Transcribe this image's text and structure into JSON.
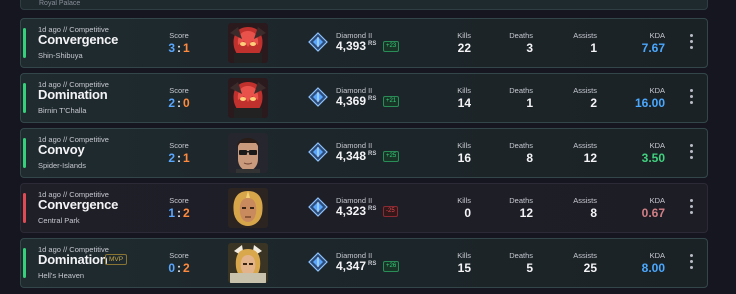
{
  "top_partial": {
    "map": "Royal Palace"
  },
  "labels": {
    "score": "Score",
    "kills": "Kills",
    "deaths": "Deaths",
    "assists": "Assists",
    "kda": "KDA",
    "rs": "RS"
  },
  "matches": [
    {
      "result": "win",
      "meta": "1d ago // Competitive",
      "mode": "Convergence",
      "map": "Shin-Shibuya",
      "score_a": "3",
      "score_b": "1",
      "hero": "hero-portrait-red-masked",
      "rank": "Diamond II",
      "rank_score": "4,393",
      "rank_delta": "+23",
      "kills": "22",
      "deaths": "3",
      "assists": "1",
      "kda": "7.67",
      "kda_color": "#4aa8ff"
    },
    {
      "result": "win",
      "meta": "1d ago // Competitive",
      "mode": "Domination",
      "map": "Birnin T'Challa",
      "score_a": "2",
      "score_b": "0",
      "hero": "hero-portrait-red-masked",
      "rank": "Diamond II",
      "rank_score": "4,369",
      "rank_delta": "+21",
      "kills": "14",
      "deaths": "1",
      "assists": "2",
      "kda": "16.00",
      "kda_color": "#4aa8ff"
    },
    {
      "result": "win",
      "meta": "1d ago // Competitive",
      "mode": "Convoy",
      "map": "Spider-Islands",
      "score_a": "2",
      "score_b": "1",
      "hero": "hero-portrait-glasses",
      "rank": "Diamond II",
      "rank_score": "4,348",
      "rank_delta": "+25",
      "kills": "16",
      "deaths": "8",
      "assists": "12",
      "kda": "3.50",
      "kda_color": "#40d17e"
    },
    {
      "result": "loss",
      "meta": "1d ago // Competitive",
      "mode": "Convergence",
      "map": "Central Park",
      "score_a": "1",
      "score_b": "2",
      "hero": "hero-portrait-gold",
      "rank": "Diamond II",
      "rank_score": "4,323",
      "rank_delta": "-25",
      "kills": "0",
      "deaths": "12",
      "assists": "8",
      "kda": "0.67",
      "kda_color": "#d27f85"
    },
    {
      "result": "win",
      "meta": "1d ago // Competitive",
      "mode": "Domination",
      "map": "Hell's Heaven",
      "mvp": "MVP",
      "score_a": "0",
      "score_b": "2",
      "hero": "hero-portrait-gold-helm",
      "rank": "Diamond II",
      "rank_score": "4,347",
      "rank_delta": "+26",
      "kills": "15",
      "deaths": "5",
      "assists": "25",
      "kda": "8.00",
      "kda_color": "#4aa8ff"
    }
  ]
}
